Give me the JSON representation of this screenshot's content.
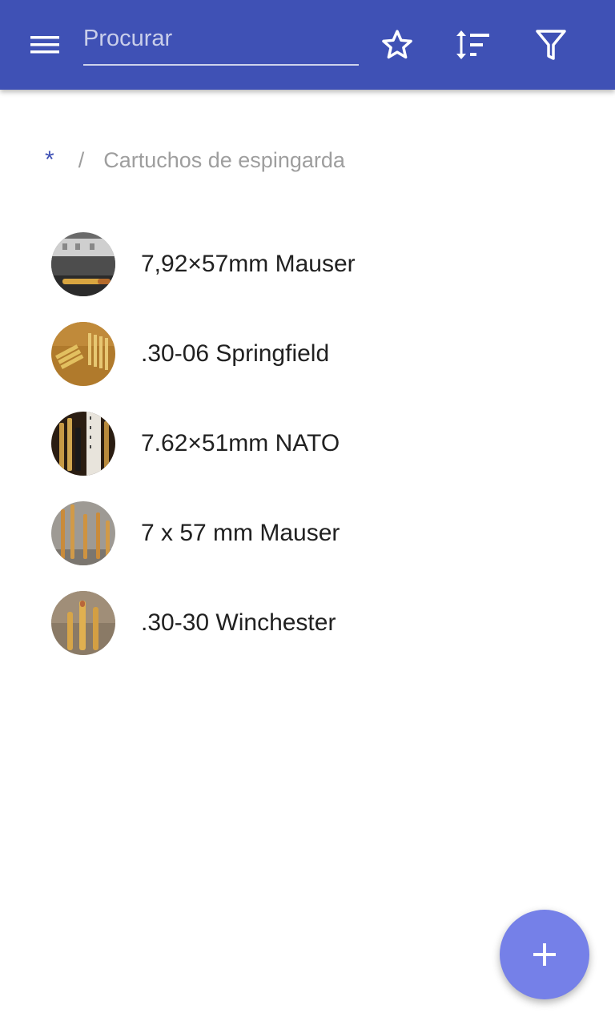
{
  "header": {
    "menu_icon": "hamburger-menu-icon",
    "search": {
      "placeholder": "Procurar",
      "value": ""
    },
    "actions": [
      {
        "name": "favorites",
        "icon": "star-outline-icon"
      },
      {
        "name": "sort",
        "icon": "sort-icon"
      },
      {
        "name": "filter",
        "icon": "filter-icon"
      }
    ]
  },
  "breadcrumb": {
    "root": "*",
    "separator": "/",
    "current": "Cartuchos de espingarda"
  },
  "items": [
    {
      "label": "7,92×57mm Mauser",
      "thumbnail": "cartridge-photo"
    },
    {
      "label": ".30-06 Springfield",
      "thumbnail": "cartridge-photo"
    },
    {
      "label": "7.62×51mm NATO",
      "thumbnail": "cartridge-photo"
    },
    {
      "label": "7 x 57 mm Mauser",
      "thumbnail": "cartridge-photo"
    },
    {
      "label": ".30-30 Winchester",
      "thumbnail": "cartridge-photo"
    }
  ],
  "fab": {
    "icon": "plus-icon"
  },
  "colors": {
    "app_bar": "#3f51b5",
    "accent": "#3f51b5",
    "fab": "#7580e8",
    "text_primary": "#212121",
    "text_secondary": "#9e9e9e"
  }
}
